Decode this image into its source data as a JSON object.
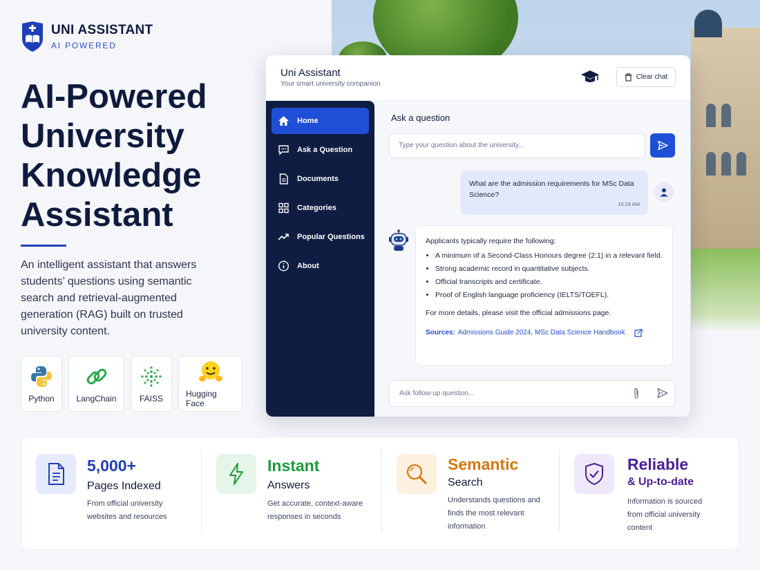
{
  "brand": {
    "title": "UNI ASSISTANT",
    "subtitle": "AI POWERED"
  },
  "hero": {
    "title": "AI-Powered University Knowledge Assistant",
    "description": "An intelligent assistant that answers students’ questions using semantic search and retrieval-augmented generation (RAG) built on trusted university content."
  },
  "tech": [
    {
      "label": "Python",
      "icon": "python-icon"
    },
    {
      "label": "LangChain",
      "icon": "chain-link-icon"
    },
    {
      "label": "FAISS",
      "icon": "dot-cluster-icon"
    },
    {
      "label": "Hugging Face",
      "icon": "hugging-face-icon"
    }
  ],
  "app": {
    "title": "Uni Assistant",
    "subtitle": "Your smart university companion",
    "clear_label": "Clear chat",
    "nav": [
      {
        "label": "Home",
        "icon": "home-icon",
        "active": true
      },
      {
        "label": "Ask a Question",
        "icon": "chat-bubble-icon"
      },
      {
        "label": "Documents",
        "icon": "document-icon"
      },
      {
        "label": "Categories",
        "icon": "grid-icon"
      },
      {
        "label": "Popular Questions",
        "icon": "trending-icon"
      },
      {
        "label": "About",
        "icon": "info-icon"
      }
    ],
    "ask_title": "Ask a question",
    "question_placeholder": "Type your question about the university...",
    "user_message": "What are the admission requirements for MSc Data Science?",
    "user_time": "10:24 AM",
    "bot": {
      "intro": "Applicants typically require the following:",
      "bullets": [
        "A minimum of a Second-Class Honours degree (2:1) in a relevant field.",
        "Strong academic record in quantitative subjects.",
        "Official transcripts and certificate.",
        "Proof of English language proficiency (IELTS/TOEFL)."
      ],
      "more": "For more details, please visit the official admissions page.",
      "sources_label": "Sources:",
      "sources": "Admissions Guide 2024, MSc Data Science Handbook"
    },
    "followup_placeholder": "Ask follow-up question..."
  },
  "stats": [
    {
      "big": "5,000+",
      "mid": "Pages Indexed",
      "desc": "From official university websites and resources",
      "color": "#1f3fb8",
      "bg": "#e6ebfb",
      "icon": "document-icon"
    },
    {
      "big": "Instant",
      "mid": "Answers",
      "desc": "Get accurate, context-aware responses in seconds",
      "color": "#1e9a3a",
      "bg": "#e5f5e9",
      "icon": "lightning-icon"
    },
    {
      "big": "Semantic",
      "mid": "Search",
      "desc": "Understands questions and finds the most relevant information",
      "color": "#d4780f",
      "bg": "#fdf0df",
      "icon": "magnifier-icon"
    },
    {
      "big": "Reliable",
      "mid": "& Up-to-date",
      "desc": "Information is sourced from official university content",
      "color": "#4b1f9a",
      "bg": "#efe8fb",
      "icon": "shield-check-icon"
    }
  ]
}
